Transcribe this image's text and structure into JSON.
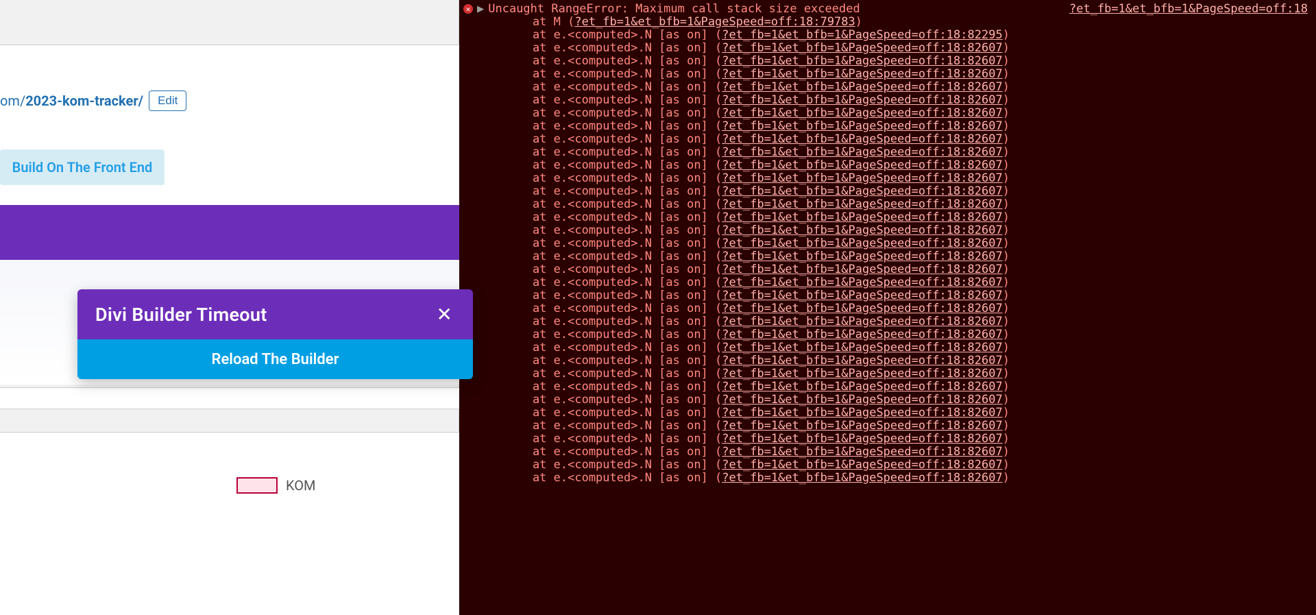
{
  "left": {
    "permalink_prefix": "om/",
    "permalink_slug": "2023-kom-tracker/",
    "edit_label": "Edit",
    "build_button": "Build On The Front End",
    "timeout_title": "Divi Builder Timeout",
    "reload_label": "Reload The Builder",
    "legend_label": "KOM"
  },
  "console": {
    "error_message": "Uncaught RangeError: Maximum call stack size exceeded",
    "source_link_top": "?et_fb=1&et_bfb=1&PageSpeed=off:18",
    "first_frame_prefix": "at M (",
    "first_frame_link": "?et_fb=1&et_bfb=1&PageSpeed=off:18:79783",
    "first_frame_suffix": ")",
    "repeat_frame_prefix": "at e.<computed>.N [as on] (",
    "second_frame_link": "?et_fb=1&et_bfb=1&PageSpeed=off:18:82295",
    "repeat_frame_link": "?et_fb=1&et_bfb=1&PageSpeed=off:18:82607",
    "repeat_frame_suffix": ")",
    "repeat_count": 34
  }
}
